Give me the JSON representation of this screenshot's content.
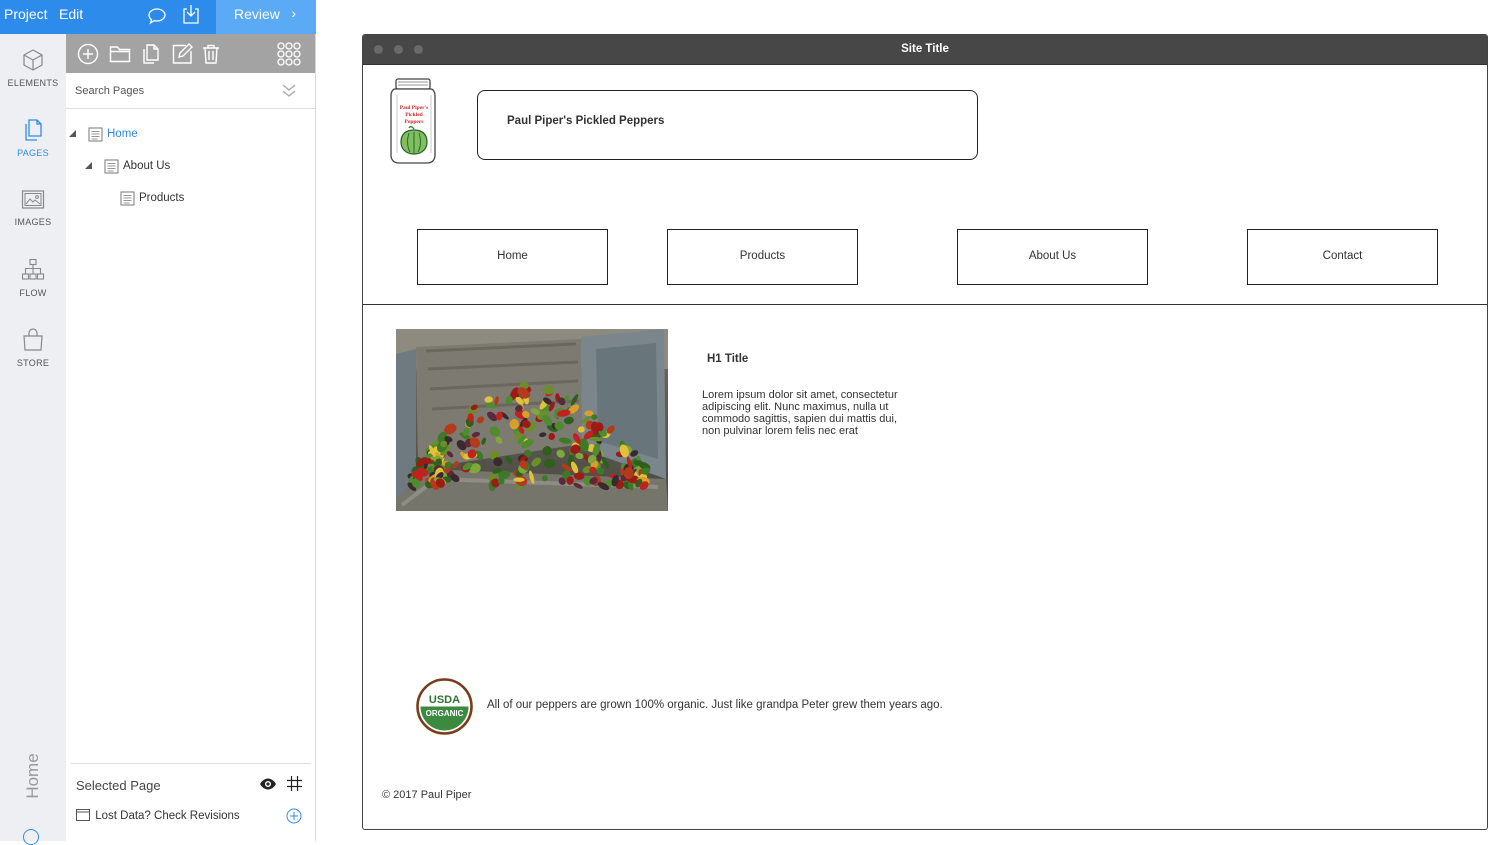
{
  "topbar": {
    "project_label": "Project",
    "edit_label": "Edit",
    "review_label": "Review",
    "accent_color": "#2d8ceb"
  },
  "rail": {
    "items": [
      {
        "label": "ELEMENTS",
        "icon": "cube-icon"
      },
      {
        "label": "PAGES",
        "icon": "pages-icon",
        "active": true
      },
      {
        "label": "IMAGES",
        "icon": "image-icon"
      },
      {
        "label": "FLOW",
        "icon": "flow-icon"
      },
      {
        "label": "STORE",
        "icon": "bag-icon"
      }
    ],
    "current_page_vertical": "Home"
  },
  "pages_panel": {
    "toolbar_icons": [
      "add-page-icon",
      "add-folder-icon",
      "duplicate-icon",
      "edit-icon",
      "delete-icon",
      "grid-menu-icon"
    ],
    "search_placeholder": "Search Pages",
    "tree": [
      {
        "label": "Home",
        "selected": true
      },
      {
        "label": "About Us"
      },
      {
        "label": "Products"
      }
    ],
    "selected_page_label": "Selected Page",
    "revisions_label": "Lost Data? Check Revisions"
  },
  "site": {
    "title": "Site Title",
    "brand_name": "Paul Piper's Pickled Peppers",
    "nav": [
      "Home",
      "Products",
      "About Us",
      "Contact"
    ],
    "h1": "H1 Title",
    "body": "Lorem ipsum dolor sit amet, consectetur adipiscing elit. Nunc maximus, nulla ut commodo sagittis, sapien dui mattis dui, non pulvinar lorem felis nec erat",
    "organic_note": "All of our peppers are grown 100% organic. Just like grandpa Peter grew them years ago.",
    "copyright": "© 2017 Paul Piper",
    "usda_logo_text": [
      "USDA",
      "ORGANIC"
    ],
    "jar_label_text": [
      "Paul Piper's",
      "Pickled",
      "Peppers"
    ]
  }
}
